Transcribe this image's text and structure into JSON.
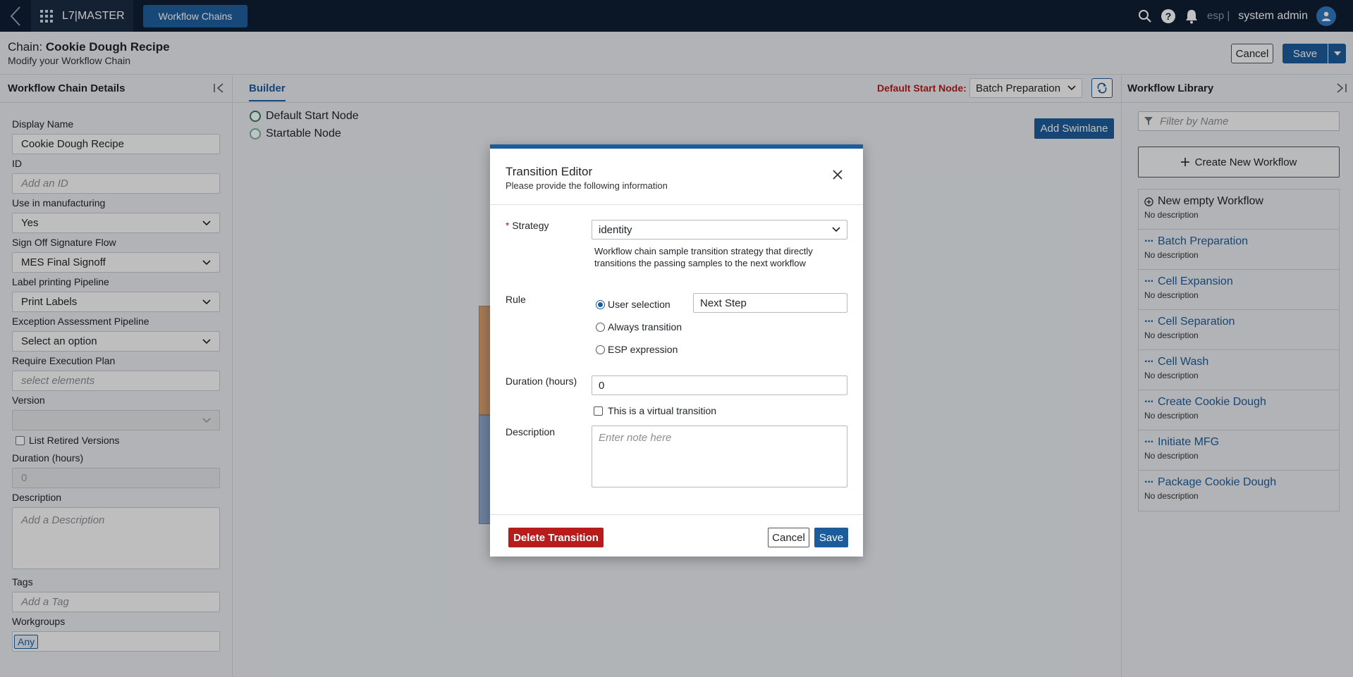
{
  "topnav": {
    "brand": "L7|MASTER",
    "active_pill": "Workflow Chains",
    "esp_label": "esp |",
    "user_name": "system admin"
  },
  "header": {
    "title_prefix": "Chain:",
    "title_name": "Cookie Dough Recipe",
    "subtitle": "Modify your Workflow Chain",
    "cancel_label": "Cancel",
    "save_label": "Save"
  },
  "left_panel": {
    "title": "Workflow Chain Details",
    "display_name_label": "Display Name",
    "display_name_value": "Cookie Dough Recipe",
    "id_label": "ID",
    "id_placeholder": "Add an ID",
    "use_in_mfg_label": "Use in manufacturing",
    "use_in_mfg_value": "Yes",
    "signoff_label": "Sign Off Signature Flow",
    "signoff_value": "MES Final Signoff",
    "label_pipeline_label": "Label printing Pipeline",
    "label_pipeline_value": "Print Labels",
    "exception_label": "Exception Assessment Pipeline",
    "exception_value": "Select an option",
    "require_plan_label": "Require Execution Plan",
    "require_plan_placeholder": "select elements",
    "version_label": "Version",
    "version_value": "",
    "list_retired_label": "List Retired Versions",
    "duration_label": "Duration (hours)",
    "duration_value": "0",
    "description_label": "Description",
    "description_placeholder": "Add a Description",
    "tags_label": "Tags",
    "tags_placeholder": "Add a Tag",
    "workgroups_label": "Workgroups",
    "workgroups_tag": "Any"
  },
  "builder": {
    "tab_label": "Builder",
    "default_start_label": "Default Start Node:",
    "default_start_value": "Batch Preparation",
    "legend_default": "Default Start Node",
    "legend_startable": "Startable Node",
    "add_swimlane_label": "Add Swimlane"
  },
  "right_panel": {
    "title": "Workflow Library",
    "filter_placeholder": "Filter by Name",
    "create_new_label": "Create New Workflow",
    "items": [
      {
        "name": "New empty Workflow",
        "desc": "No description"
      },
      {
        "name": "Batch Preparation",
        "desc": "No description"
      },
      {
        "name": "Cell Expansion",
        "desc": "No description"
      },
      {
        "name": "Cell Separation",
        "desc": "No description"
      },
      {
        "name": "Cell Wash",
        "desc": "No description"
      },
      {
        "name": "Create Cookie Dough",
        "desc": "No description"
      },
      {
        "name": "Initiate MFG",
        "desc": "No description"
      },
      {
        "name": "Package Cookie Dough",
        "desc": "No description"
      }
    ]
  },
  "modal": {
    "title": "Transition Editor",
    "subtitle": "Please provide the following information",
    "strategy_label": "Strategy",
    "strategy_value": "identity",
    "strategy_help": "Workflow chain sample transition strategy that directly transitions the passing samples to the next workflow",
    "rule_label": "Rule",
    "rule_user_selection": "User selection",
    "rule_user_selection_value": "Next Step",
    "rule_always": "Always transition",
    "rule_esp": "ESP expression",
    "duration_label": "Duration (hours)",
    "duration_value": "0",
    "virtual_label": "This is a virtual transition",
    "description_label": "Description",
    "description_placeholder": "Enter note here",
    "delete_label": "Delete Transition",
    "cancel_label": "Cancel",
    "save_label": "Save"
  },
  "colors": {
    "nav_bg": "#0f1e33",
    "accent": "#1c5c9c",
    "danger": "#b71c1c",
    "node_ring": "#2e7d5b"
  }
}
